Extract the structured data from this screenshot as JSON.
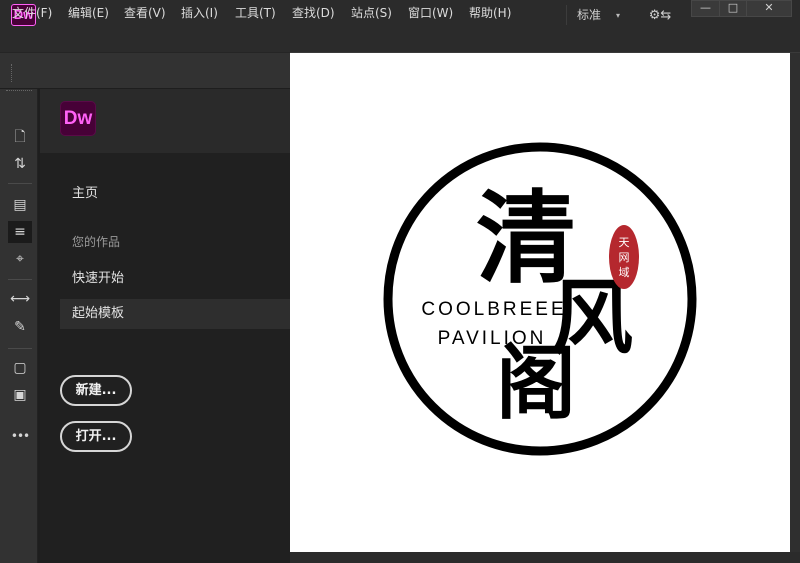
{
  "app": {
    "logo_text": "Dw"
  },
  "titlebar": {
    "workspace_label": "标准",
    "caret": "▾",
    "sync_glyph": "⚙⇆",
    "minimize": "—",
    "maximize": "□",
    "close": "✕"
  },
  "menu": {
    "items": [
      "文件(F)",
      "编辑(E)",
      "查看(V)",
      "插入(I)",
      "工具(T)",
      "查找(D)",
      "站点(S)",
      "窗口(W)",
      "帮助(H)"
    ]
  },
  "sidebar": {
    "icons": [
      {
        "name": "new-file-icon",
        "glyph": "🗋"
      },
      {
        "name": "file-transfer-icon",
        "glyph": "⇅"
      },
      {
        "name": "live-view-inspect-icon",
        "glyph": "▤"
      },
      {
        "name": "format-source-icon",
        "glyph": "≡"
      },
      {
        "name": "target-icon",
        "glyph": "⌖"
      },
      {
        "name": "expand-collapse-icon",
        "glyph": "⟷"
      },
      {
        "name": "edit-tag-icon",
        "glyph": "✎"
      },
      {
        "name": "comment-icon",
        "glyph": "▢"
      },
      {
        "name": "comment-remove-icon",
        "glyph": "▣"
      },
      {
        "name": "more-icon",
        "glyph": "•••"
      }
    ]
  },
  "home": {
    "logo_text": "Dw",
    "nav": {
      "home": "主页",
      "section_title": "您的作品",
      "quick_start": "快速开始",
      "starter_templates": "起始模板"
    },
    "new_button": "新建...",
    "open_button": "打开..."
  },
  "canvas": {
    "logo": {
      "big_char_1": "清",
      "big_char_2": "风",
      "big_char_3": "阁",
      "english_line_1": "COOLBREEE",
      "english_line_2": "PAVILION",
      "seal_chars": [
        "天",
        "网",
        "域"
      ]
    },
    "colors": {
      "ink": "#000000",
      "seal": "#b5282e",
      "background": "#ffffff"
    }
  }
}
